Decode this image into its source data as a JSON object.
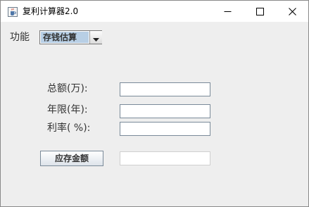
{
  "window": {
    "title": "复利计算器2.0",
    "app_icon": "java-coffee-cup-icon",
    "controls": {
      "minimize_icon": "minimize-icon",
      "maximize_icon": "maximize-icon",
      "close_icon": "close-icon"
    }
  },
  "function_selector": {
    "label": "功能",
    "selected": "存钱估算",
    "arrow_icon": "chevron-down-icon"
  },
  "form": {
    "total_label": "总额(万):",
    "total_value": "",
    "years_label": "年限(年):",
    "years_value": "",
    "rate_label": "利率( %):",
    "rate_value": ""
  },
  "action": {
    "button_label": "应存金额",
    "result_value": ""
  },
  "colors": {
    "window_background": "#eeeeee",
    "titlebar_background": "#ffffff",
    "combo_selection": "#b8cfe5",
    "label_text": "#333333"
  }
}
